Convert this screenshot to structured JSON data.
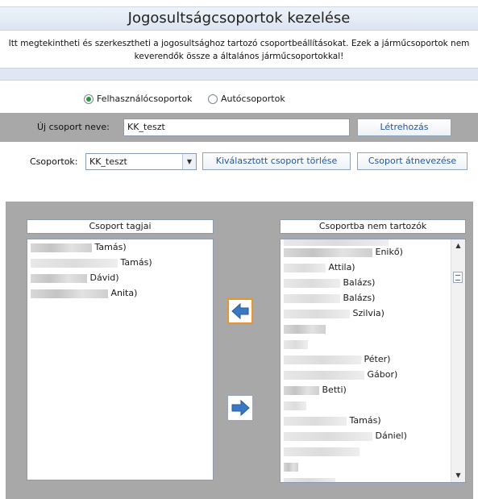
{
  "header": {
    "title": "Jogosultságcsoportok kezelése",
    "description": "Itt megtekintheti és szerkesztheti a jogosultsághoz tartozó csoportbeállításokat. Ezek a járműcsoportok nem\nkeverendők össze a általános járműcsoportokkal!"
  },
  "group_type": {
    "options": [
      {
        "label": "Felhasználócsoportok",
        "selected": true
      },
      {
        "label": "Autócsoportok",
        "selected": false
      }
    ]
  },
  "new_group": {
    "label": "Új csoport neve:",
    "value": "KK_teszt",
    "create_button": "Létrehozás"
  },
  "groups": {
    "label": "Csoportok:",
    "selected": "KK_teszt",
    "delete_button": "Kiválasztott csoport törlése",
    "rename_button": "Csoport átnevezése"
  },
  "members": {
    "header": "Csoport tagjai",
    "items": [
      "Tamás)",
      "Tamás)",
      "Dávid)",
      "Anita)"
    ]
  },
  "non_members": {
    "header": "Csoportba nem tartozók",
    "items": [
      "Enikő)",
      "Attila)",
      "Balázs)",
      "Balázs)",
      "Szilvia)",
      "",
      "",
      "Péter)",
      "Gábor)",
      "Betti)",
      "",
      "Tamás)",
      "Dániel)",
      "",
      "",
      ""
    ]
  },
  "colors": {
    "selection_border": "#e8962b",
    "arrow_blue": "#3b78c4",
    "panel_gray": "#a8a8a8",
    "radio_selected": "#1f9d3a"
  },
  "icons": {
    "move_left": "arrow-left-icon",
    "move_right": "arrow-right-icon"
  }
}
